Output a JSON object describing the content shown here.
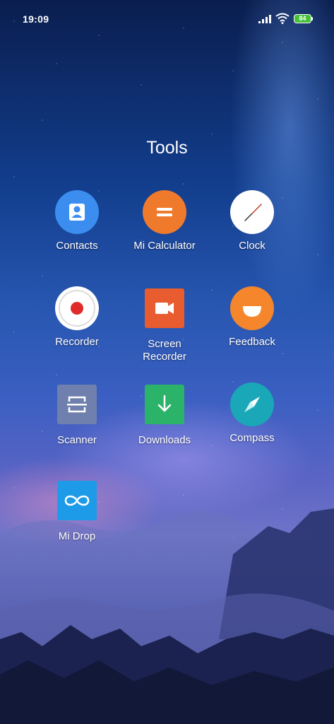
{
  "status_bar": {
    "time": "19:09",
    "battery_level": "84"
  },
  "folder": {
    "title": "Tools"
  },
  "apps": [
    {
      "label": "Contacts",
      "icon": "contacts-icon",
      "color": "#3b8ef0"
    },
    {
      "label": "Mi Calculator",
      "icon": "calculator-icon",
      "color": "#f07a2c"
    },
    {
      "label": "Clock",
      "icon": "clock-icon",
      "color": "#ffffff"
    },
    {
      "label": "Recorder",
      "icon": "recorder-icon",
      "color": "#ffffff"
    },
    {
      "label": "Screen\nRecorder",
      "icon": "screen-recorder-icon",
      "color": "#e85c2f"
    },
    {
      "label": "Feedback",
      "icon": "feedback-icon",
      "color": "#f5862c"
    },
    {
      "label": "Scanner",
      "icon": "scanner-icon",
      "color": "#6f80ae"
    },
    {
      "label": "Downloads",
      "icon": "downloads-icon",
      "color": "#2bb36a"
    },
    {
      "label": "Compass",
      "icon": "compass-icon",
      "color": "#1aa7b8"
    },
    {
      "label": "Mi Drop",
      "icon": "mi-drop-icon",
      "color": "#1e9be8"
    }
  ]
}
